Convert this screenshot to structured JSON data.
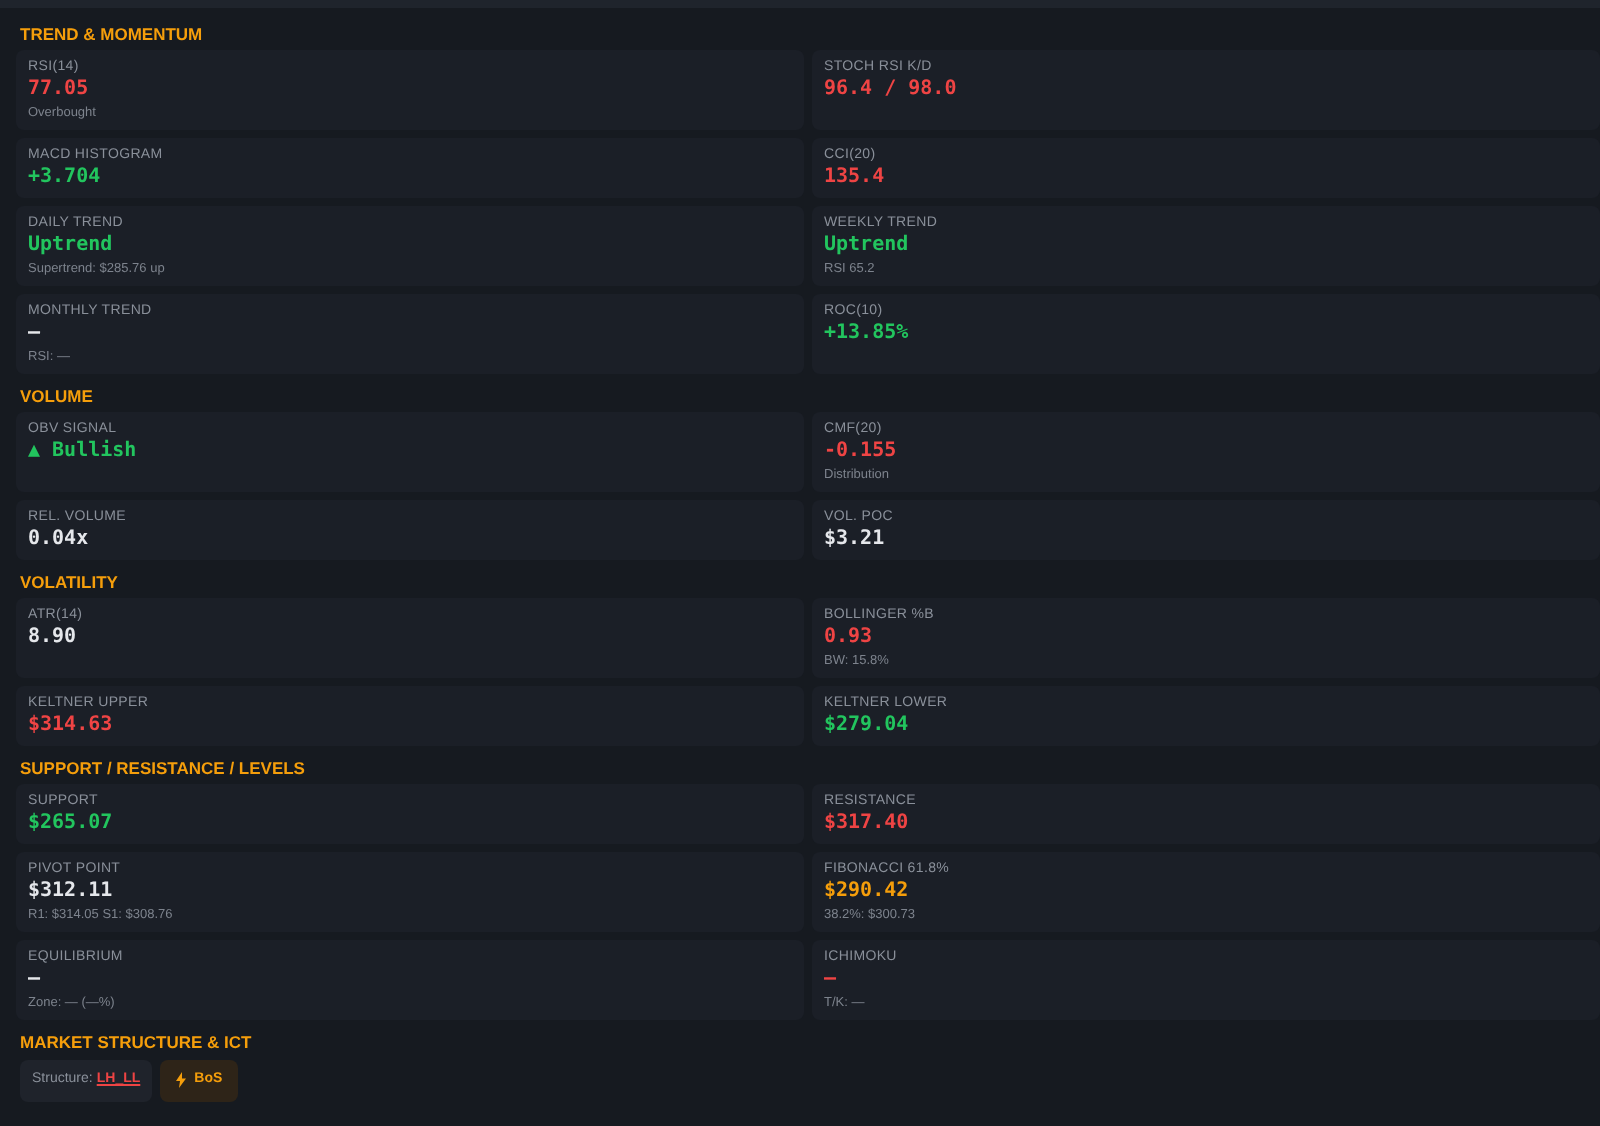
{
  "sections": [
    {
      "title": "TREND & MOMENTUM",
      "metrics": [
        {
          "label": "RSI(14)",
          "value": "77.05",
          "color": "#ef4444",
          "note": "Overbought"
        },
        {
          "label": "STOCH RSI K/D",
          "value": "96.4 / 98.0",
          "color": "#ef4444"
        },
        {
          "label": "MACD HISTOGRAM",
          "value": "+3.704",
          "color": "#22c55e"
        },
        {
          "label": "CCI(20)",
          "value": "135.4",
          "color": "#ef4444"
        },
        {
          "label": "DAILY TREND",
          "value": "Uptrend",
          "color": "#22c55e",
          "note": "Supertrend: $285.76 up"
        },
        {
          "label": "WEEKLY TREND",
          "value": "Uptrend",
          "color": "#22c55e",
          "note": "RSI 65.2"
        },
        {
          "label": "MONTHLY TREND",
          "value": "—",
          "color": "#e5e7eb",
          "note": "RSI: —"
        },
        {
          "label": "ROC(10)",
          "value": "+13.85%",
          "color": "#22c55e"
        }
      ]
    },
    {
      "title": "VOLUME",
      "metrics": [
        {
          "label": "OBV SIGNAL",
          "value": "▲ Bullish",
          "color": "#22c55e"
        },
        {
          "label": "CMF(20)",
          "value": "-0.155",
          "color": "#ef4444",
          "note": "Distribution"
        },
        {
          "label": "REL. VOLUME",
          "value": "0.04x",
          "color": "#e5e7eb"
        },
        {
          "label": "VOL. POC",
          "value": "$3.21",
          "color": "#e5e7eb"
        }
      ]
    },
    {
      "title": "VOLATILITY",
      "metrics": [
        {
          "label": "ATR(14)",
          "value": "8.90",
          "color": "#e5e7eb"
        },
        {
          "label": "BOLLINGER %B",
          "value": "0.93",
          "color": "#ef4444",
          "note": "BW: 15.8%"
        },
        {
          "label": "KELTNER UPPER",
          "value": "$314.63",
          "color": "#ef4444"
        },
        {
          "label": "KELTNER LOWER",
          "value": "$279.04",
          "color": "#22c55e"
        }
      ]
    },
    {
      "title": "SUPPORT / RESISTANCE / LEVELS",
      "metrics": [
        {
          "label": "SUPPORT",
          "value": "$265.07",
          "color": "#22c55e"
        },
        {
          "label": "RESISTANCE",
          "value": "$317.40",
          "color": "#ef4444"
        },
        {
          "label": "PIVOT POINT",
          "value": "$312.11",
          "color": "#e5e7eb",
          "note": "R1: $314.05 S1: $308.76"
        },
        {
          "label": "FIBONACCI 61.8%",
          "value": "$290.42",
          "color": "#f59e0b",
          "note": "38.2%: $300.73"
        },
        {
          "label": "EQUILIBRIUM",
          "value": "—",
          "color": "#e5e7eb",
          "note": "Zone: — (—%)"
        },
        {
          "label": "ICHIMOKU",
          "value": "—",
          "color": "#ef4444",
          "note": "T/K: —"
        }
      ]
    },
    {
      "title": "MARKET STRUCTURE & ICT",
      "tags": [
        {
          "kind": "structure",
          "label": "Structure:",
          "value": "LH_LL",
          "color": "#ef4444"
        },
        {
          "kind": "event",
          "value": "BoS",
          "color": "#f59e0b"
        }
      ]
    }
  ]
}
